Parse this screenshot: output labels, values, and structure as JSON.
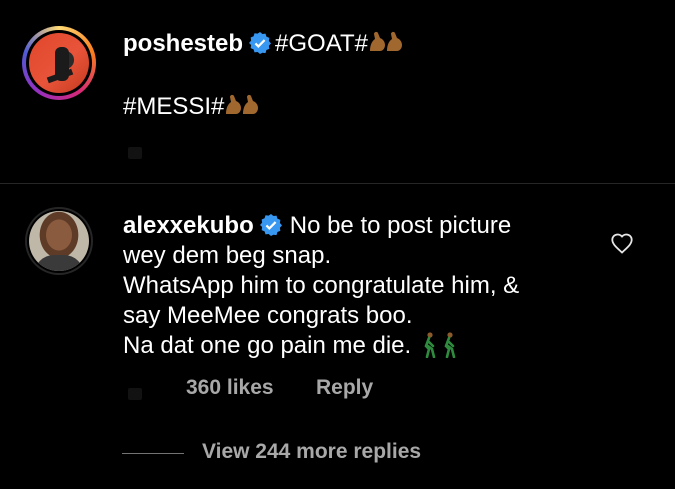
{
  "post": {
    "username": "poshesteb",
    "caption_line1": "#GOAT#",
    "caption_line2": "#MESSI#",
    "emoji": "flexed-biceps"
  },
  "comment": {
    "username": "alexxekubo",
    "line1": "No be to post picture",
    "line2": "wey dem beg snap.",
    "line3": "WhatsApp him to congratulate him, &",
    "line4": "say MeeMee congrats boo.",
    "line5": "Na dat one go pain me die.",
    "emoji": "person-walking",
    "likes": "360 likes",
    "reply": "Reply"
  },
  "replies": {
    "view_more": "View 244 more replies"
  },
  "colors": {
    "background": "#000000",
    "verified": "#3897f0",
    "muted": "#a8a8a8"
  }
}
